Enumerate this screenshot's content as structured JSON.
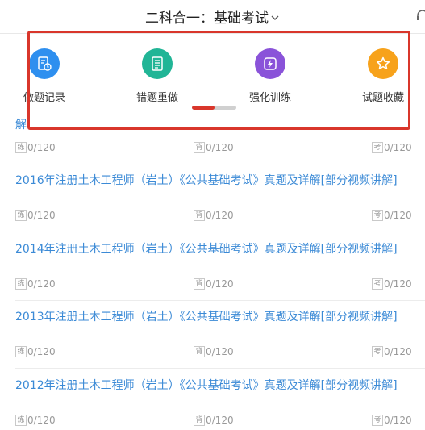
{
  "header": {
    "title": "二科合一：基础考试"
  },
  "features": [
    {
      "label": "做题记录",
      "icon": "history-icon",
      "color": "#2e8fef"
    },
    {
      "label": "错题重做",
      "icon": "list-icon",
      "color": "#21b596"
    },
    {
      "label": "强化训练",
      "icon": "bolt-icon",
      "color": "#8a53d9"
    },
    {
      "label": "试题收藏",
      "icon": "star-icon",
      "color": "#f7a21b"
    }
  ],
  "pager": {
    "active_fraction": 0.5
  },
  "tags": {
    "practice": "练",
    "memorize": "背",
    "exam": "考"
  },
  "partial_item": {
    "title_tail": "解",
    "practice": "0/120",
    "memorize": "0/120",
    "exam": "0/120"
  },
  "items": [
    {
      "title": "2016年注册土木工程师（岩土）《公共基础考试》真题及详解[部分视频讲解]",
      "practice": "0/120",
      "memorize": "0/120",
      "exam": "0/120"
    },
    {
      "title": "2014年注册土木工程师（岩土）《公共基础考试》真题及详解[部分视频讲解]",
      "practice": "0/120",
      "memorize": "0/120",
      "exam": "0/120"
    },
    {
      "title": "2013年注册土木工程师（岩土）《公共基础考试》真题及详解[部分视频讲解]",
      "practice": "0/120",
      "memorize": "0/120",
      "exam": "0/120"
    },
    {
      "title": "2012年注册土木工程师（岩土）《公共基础考试》真题及详解[部分视频讲解]",
      "practice": "0/120",
      "memorize": "0/120",
      "exam": "0/120"
    }
  ]
}
